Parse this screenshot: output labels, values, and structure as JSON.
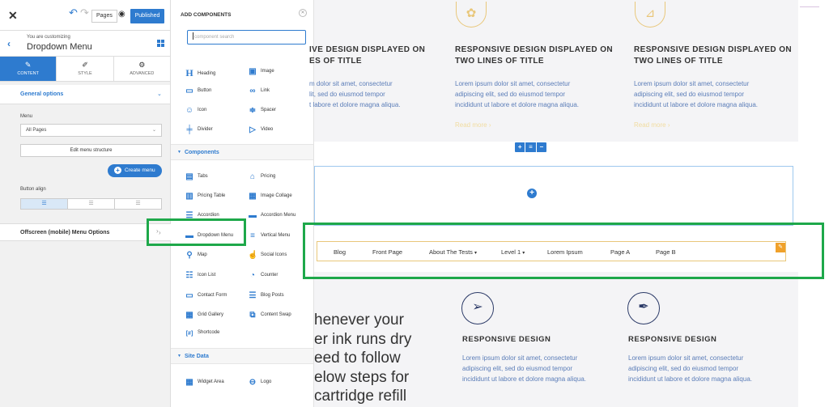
{
  "left_panel": {
    "pages_label": "Pages",
    "published_label": "Published",
    "customizing_caption": "You are customizing",
    "customizing_target": "Dropdown Menu",
    "tabs": [
      {
        "label": "CONTENT",
        "icon": "pencil-icon"
      },
      {
        "label": "STYLE",
        "icon": "brush-icon"
      },
      {
        "label": "ADVANCED",
        "icon": "gears-icon"
      }
    ],
    "general_options": "General options",
    "menu_label": "Menu",
    "menu_value": "All Pages",
    "edit_menu_structure": "Edit menu structure",
    "create_menu": "Create menu",
    "button_align_label": "Button align",
    "offscreen_label": "Offscreen (mobile) Menu Options"
  },
  "components_panel": {
    "title": "ADD COMPONENTS",
    "search_placeholder": "component search",
    "basic": [
      {
        "label": "Heading",
        "icon": "heading-icon"
      },
      {
        "label": "Image",
        "icon": "image-icon"
      },
      {
        "label": "Button",
        "icon": "button-icon"
      },
      {
        "label": "Link",
        "icon": "link-icon"
      },
      {
        "label": "Icon",
        "icon": "smiley-icon"
      },
      {
        "label": "Spacer",
        "icon": "spacer-icon"
      },
      {
        "label": "Divider",
        "icon": "divider-icon"
      },
      {
        "label": "Video",
        "icon": "video-icon"
      }
    ],
    "components_header": "Components",
    "components": [
      {
        "label": "Tabs",
        "icon": "tabs-icon"
      },
      {
        "label": "Pricing",
        "icon": "tag-icon"
      },
      {
        "label": "Pricing Table",
        "icon": "pricing-table-icon"
      },
      {
        "label": "Image Collage",
        "icon": "image-collage-icon"
      },
      {
        "label": "Accordion",
        "icon": "accordion-icon"
      },
      {
        "label": "Accordion Menu",
        "icon": "accordion-menu-icon"
      },
      {
        "label": "Dropdown Menu",
        "icon": "dropdown-menu-icon"
      },
      {
        "label": "Vertical Menu",
        "icon": "vertical-menu-icon"
      },
      {
        "label": "Map",
        "icon": "map-pin-icon"
      },
      {
        "label": "Social Icons",
        "icon": "thumbs-up-icon"
      },
      {
        "label": "Icon List",
        "icon": "icon-list-icon"
      },
      {
        "label": "Counter",
        "icon": "counter-icon"
      },
      {
        "label": "Contact Form",
        "icon": "contact-form-icon"
      },
      {
        "label": "Blog Posts",
        "icon": "blog-posts-icon"
      },
      {
        "label": "Grid Gallery",
        "icon": "grid-gallery-icon"
      },
      {
        "label": "Content Swap",
        "icon": "content-swap-icon"
      },
      {
        "label": "Shortcode",
        "icon": "shortcode-icon"
      }
    ],
    "site_data_header": "Site Data",
    "site_data": [
      {
        "label": "Widget Area",
        "icon": "widget-area-icon"
      },
      {
        "label": "Logo",
        "icon": "logo-icon"
      }
    ]
  },
  "canvas": {
    "top_cards": [
      {
        "title_l1": "IVE DESIGN DISPLAYED ON",
        "title_l2": "ES OF TITLE",
        "body_l1": "m dolor sit amet, consectetur",
        "body_l2": "lit, sed do eiusmod tempor",
        "body_l3": "t labore et dolore magna aliqua.",
        "read_more": ""
      },
      {
        "title_l1": "RESPONSIVE DESIGN DISPLAYED ON",
        "title_l2": "TWO LINES OF TITLE",
        "body_l1": "Lorem ipsum dolor sit amet, consectetur",
        "body_l2": "adipiscing elit, sed do eiusmod tempor",
        "body_l3": "incididunt ut labore et dolore magna aliqua.",
        "read_more": "Read more"
      },
      {
        "title_l1": "RESPONSIVE DESIGN DISPLAYED ON",
        "title_l2": "TWO LINES OF TITLE",
        "body_l1": "Lorem ipsum dolor sit amet, consectetur",
        "body_l2": "adipiscing elit, sed do eiusmod tempor",
        "body_l3": "incididunt ut labore et dolore magna aliqua.",
        "read_more": "Read more"
      }
    ],
    "menu_items": [
      "Blog",
      "Front Page",
      "About The Tests",
      "Level 1",
      "Lorem Ipsum",
      "Page A",
      "Page B"
    ],
    "big_text_lines": [
      "henever your",
      "er ink runs dry",
      "eed to follow",
      "elow steps for",
      "cartridge refill"
    ],
    "bottom_cards": [
      {
        "title": "RESPONSIVE DESIGN",
        "body_l1": "Lorem ipsum dolor sit amet, consectetur",
        "body_l2": "adipiscing elit, sed do eiusmod tempor",
        "body_l3": "incididunt ut labore et dolore magna aliqua."
      },
      {
        "title": "RESPONSIVE DESIGN",
        "body_l1": "Lorem ipsum dolor sit amet, consectetur",
        "body_l2": "adipiscing elit, sed do eiusmod tempor",
        "body_l3": "incididunt ut labore et dolore magna aliqua."
      }
    ]
  },
  "colors": {
    "accent": "#2e7bcf",
    "highlight": "#1ea84a",
    "gold": "#e9c77a"
  }
}
